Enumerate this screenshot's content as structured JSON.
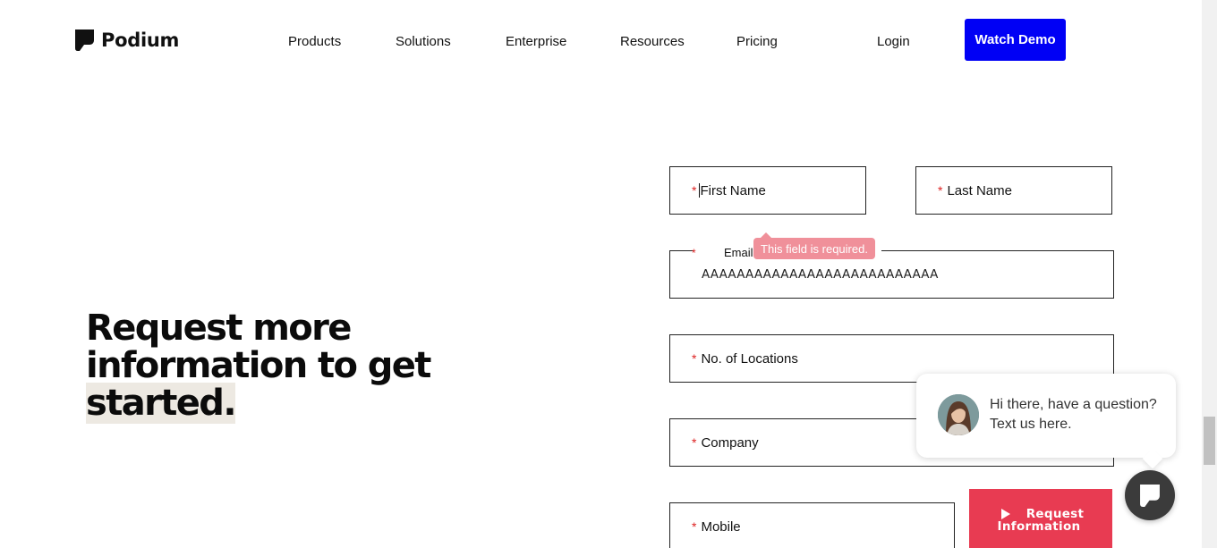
{
  "header": {
    "logo_text": "Podium",
    "nav": [
      "Products",
      "Solutions",
      "Enterprise",
      "Resources",
      "Pricing"
    ],
    "login_label": "Login",
    "demo_label": "Watch Demo",
    "demo_color": "#0000f5"
  },
  "hero": {
    "line1": "Request more",
    "line2": "information to get",
    "line3": "started."
  },
  "form": {
    "required_mark": "*",
    "first_name_label": "First Name",
    "last_name_label": "Last Name",
    "email_label": "Email",
    "email_value": "AAAAAAAAAAAAAAAAAAAAAAAAAAA",
    "email_error": "This field is required.",
    "locations_label": "No. of Locations",
    "company_label": "Company",
    "mobile_label": "Mobile",
    "submit_line1": "Request",
    "submit_line2": "Information",
    "submit_color": "#e83b52"
  },
  "chat": {
    "message": "Hi there, have a question? Text us here.",
    "launcher_icon": "podium-logo-icon"
  }
}
